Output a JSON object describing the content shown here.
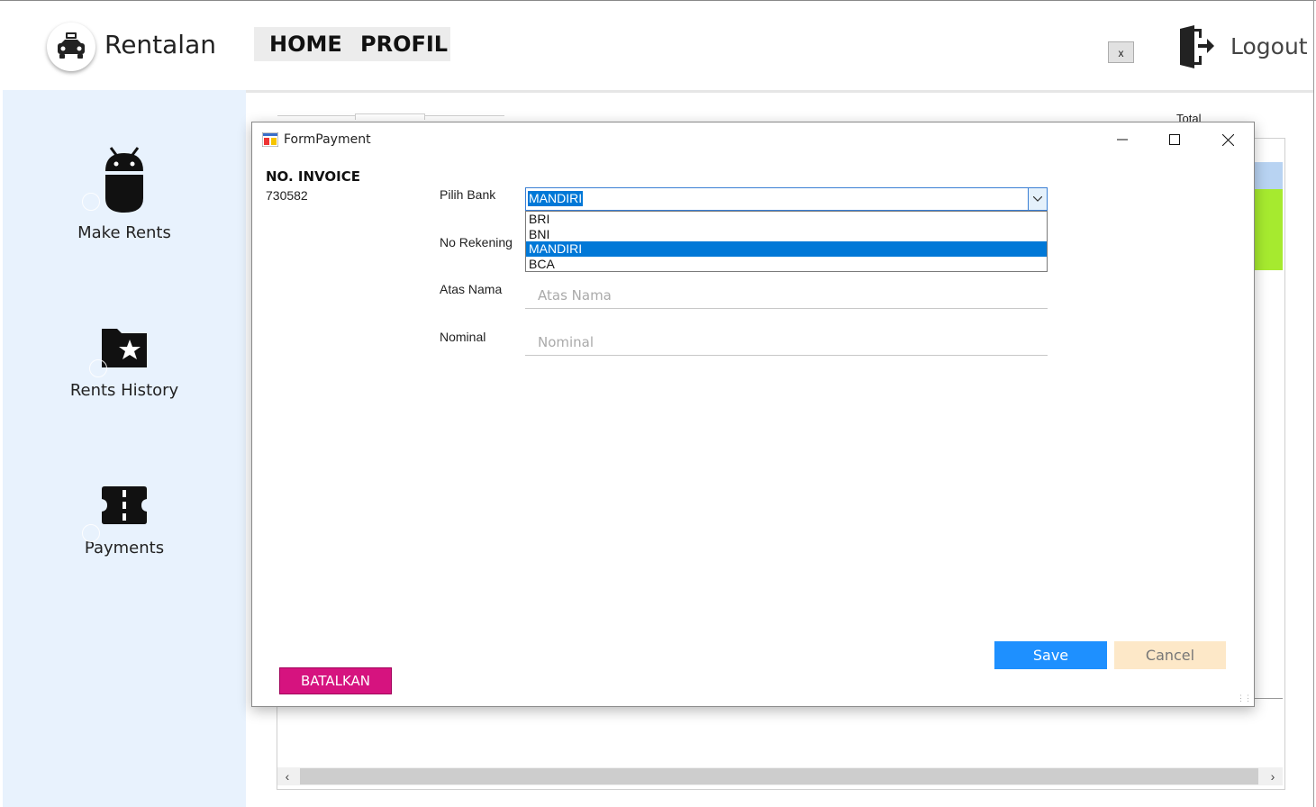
{
  "app": {
    "title": "Rentalan",
    "logo_icon": "car-icon"
  },
  "topnav": {
    "home": "HOME",
    "profil": "PROFIL"
  },
  "header": {
    "close_label": "x",
    "logout_label": "Logout",
    "logout_icon": "logout-icon"
  },
  "sidebar": {
    "items": [
      {
        "label": "Make Rents",
        "icon": "android-icon"
      },
      {
        "label": "Rents History",
        "icon": "folder-star-icon"
      },
      {
        "label": "Payments",
        "icon": "ticket-icon"
      }
    ]
  },
  "background": {
    "total_label": "Total",
    "accent_green": "#a6ea2f",
    "accent_blue": "#b8d3f2"
  },
  "dialog": {
    "title": "FormPayment",
    "invoice_label": "NO. INVOICE",
    "invoice_value": "730582",
    "fields": {
      "bank_label": "Pilih Bank",
      "bank_selected": "MANDIRI",
      "bank_options": [
        "BRI",
        "BNI",
        "MANDIRI",
        "BCA"
      ],
      "rekening_label": "No Rekening",
      "atas_nama_label": "Atas Nama",
      "atas_nama_placeholder": "Atas Nama",
      "nominal_label": "Nominal",
      "nominal_placeholder": "Nominal"
    },
    "buttons": {
      "save": "Save",
      "cancel": "Cancel",
      "batalkan": "BATALKAN"
    },
    "colors": {
      "save": "#1e90ff",
      "cancel": "#fde8c8",
      "batalkan": "#d6137f",
      "selection": "#0078d7"
    }
  }
}
